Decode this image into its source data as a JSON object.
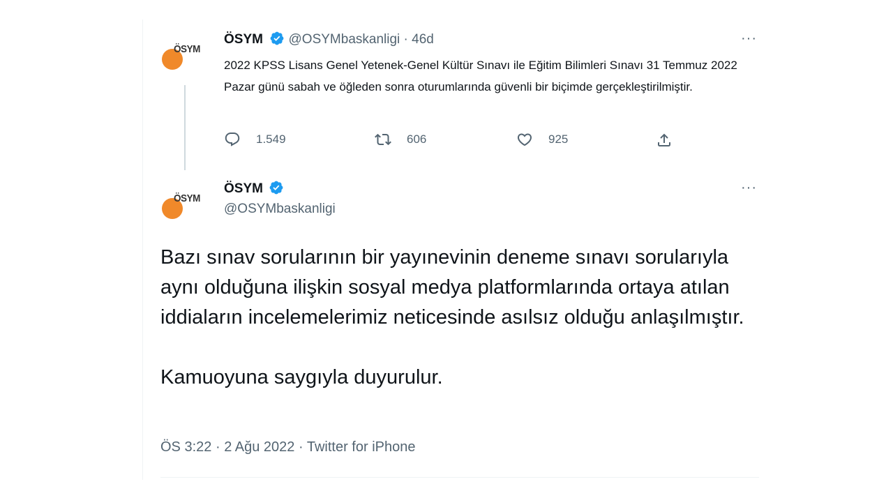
{
  "accent_color": "#1d9bf0",
  "quoted_tweet": {
    "display_name": "ÖSYM",
    "handle": "@OSYMbaskanligi",
    "separator": "·",
    "time": "46d",
    "avatar_text": "ÖSYM",
    "text": "2022 KPSS Lisans Genel Yetenek-Genel Kültür Sınavı ile Eğitim Bilimleri Sınavı 31 Temmuz 2022 Pazar günü sabah ve öğleden sonra oturumlarında güvenli bir biçimde gerçekleştirilmiştir.",
    "replies": "1.549",
    "retweets": "606",
    "likes": "925",
    "more_label": "···"
  },
  "main_tweet": {
    "display_name": "ÖSYM",
    "handle": "@OSYMbaskanligi",
    "avatar_text": "ÖSYM",
    "paragraph1": "Bazı sınav sorularının bir yayınevinin deneme sınavı sorularıyla aynı olduğuna ilişkin sosyal medya platformlarında ortaya atılan iddiaların incelemelerimiz neticesinde asılsız olduğu anlaşılmıştır.",
    "paragraph2": "Kamuoyuna saygıyla duyurulur.",
    "time": "ÖS 3:22",
    "date": "2 Ağu 2022",
    "separator": "·",
    "source": "Twitter for iPhone",
    "more_label": "···"
  }
}
